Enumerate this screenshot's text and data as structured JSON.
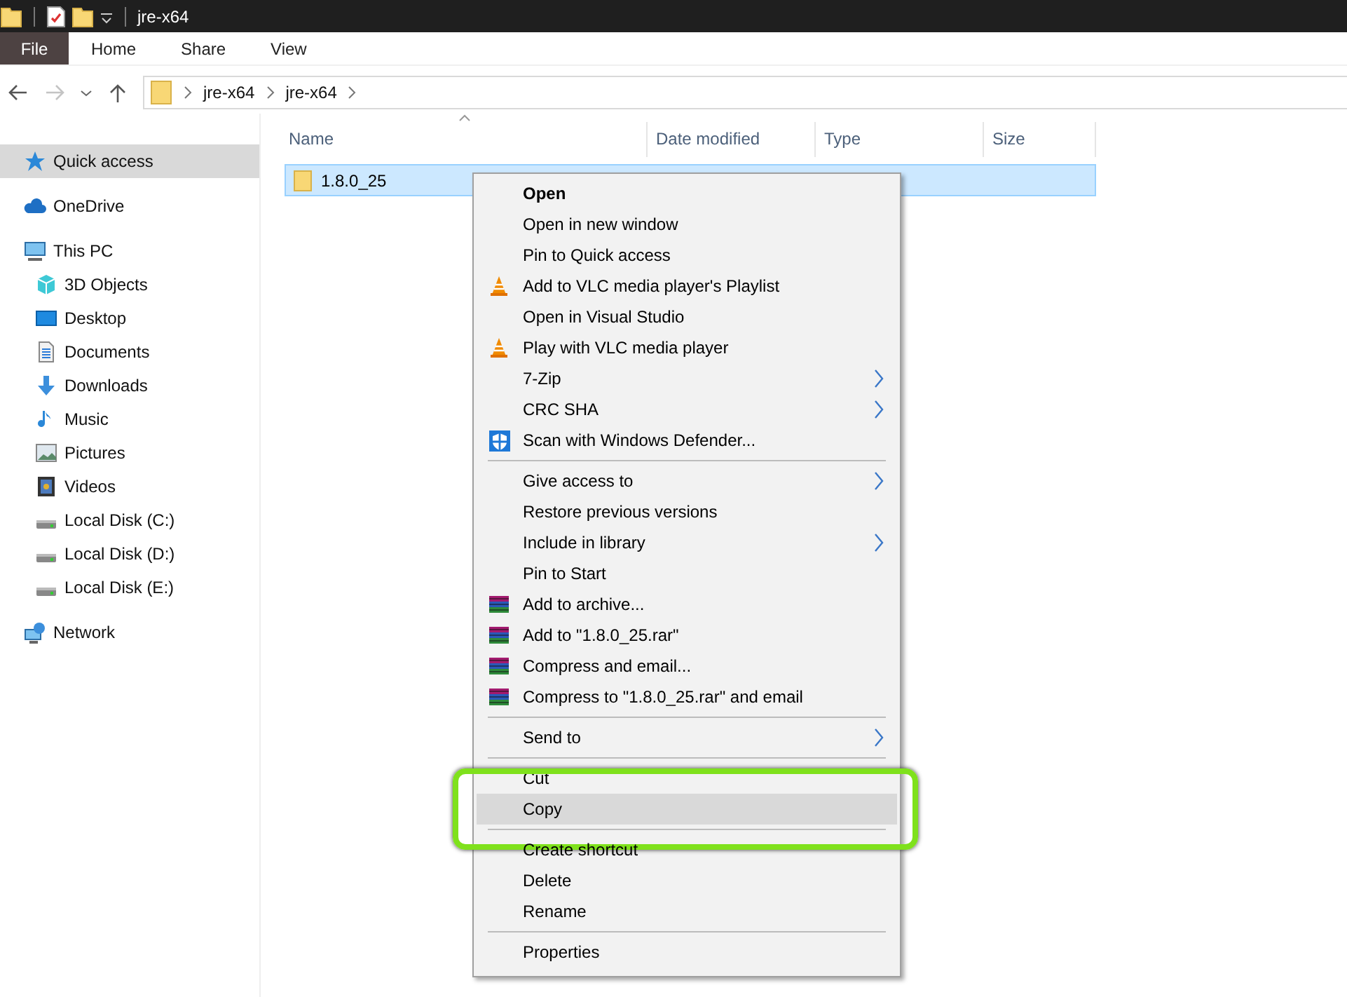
{
  "window": {
    "title": "jre-x64"
  },
  "ribbon_tabs": [
    {
      "label": "File",
      "kind": "file"
    },
    {
      "label": "Home",
      "kind": "tab"
    },
    {
      "label": "Share",
      "kind": "tab"
    },
    {
      "label": "View",
      "kind": "tab"
    }
  ],
  "navigation": {
    "forward_disabled": true
  },
  "breadcrumbs": [
    "jre-x64",
    "jre-x64"
  ],
  "sidebar": {
    "items": [
      {
        "label": "Quick access",
        "kind": "star",
        "selected": true
      },
      {
        "label": "OneDrive",
        "kind": "cloud",
        "selected": false
      },
      {
        "label": "This PC",
        "kind": "pc",
        "selected": false,
        "children": [
          {
            "label": "3D Objects",
            "kind": "cube",
            "selected": false
          },
          {
            "label": "Desktop",
            "kind": "desktop",
            "selected": false
          },
          {
            "label": "Documents",
            "kind": "docs",
            "selected": false
          },
          {
            "label": "Downloads",
            "kind": "download",
            "selected": false
          },
          {
            "label": "Music",
            "kind": "music",
            "selected": false
          },
          {
            "label": "Pictures",
            "kind": "pictures",
            "selected": false
          },
          {
            "label": "Videos",
            "kind": "videos",
            "selected": false
          },
          {
            "label": "Local Disk (C:)",
            "kind": "disk",
            "selected": false
          },
          {
            "label": "Local Disk (D:)",
            "kind": "disk",
            "selected": false
          },
          {
            "label": "Local Disk (E:)",
            "kind": "disk",
            "selected": false
          }
        ]
      },
      {
        "label": "Network",
        "kind": "network",
        "selected": false
      }
    ]
  },
  "file_list": {
    "columns": [
      "Name",
      "Date modified",
      "Type",
      "Size"
    ],
    "rows": [
      {
        "name": "1.8.0_25",
        "selected": true
      }
    ]
  },
  "context_menu": {
    "items": [
      {
        "kind": "plain",
        "label": "Open",
        "bold": true,
        "submenu": false,
        "highlighted": false
      },
      {
        "kind": "plain",
        "label": "Open in new window",
        "bold": false,
        "submenu": false,
        "highlighted": false
      },
      {
        "kind": "plain",
        "label": "Pin to Quick access",
        "bold": false,
        "submenu": false,
        "highlighted": false
      },
      {
        "kind": "vlc",
        "label": "Add to VLC media player's Playlist",
        "bold": false,
        "submenu": false,
        "highlighted": false
      },
      {
        "kind": "plain",
        "label": "Open in Visual Studio",
        "bold": false,
        "submenu": false,
        "highlighted": false
      },
      {
        "kind": "vlc",
        "label": "Play with VLC media player",
        "bold": false,
        "submenu": false,
        "highlighted": false
      },
      {
        "kind": "plain",
        "label": "7-Zip",
        "bold": false,
        "submenu": true,
        "highlighted": false
      },
      {
        "kind": "plain",
        "label": "CRC SHA",
        "bold": false,
        "submenu": true,
        "highlighted": false
      },
      {
        "kind": "defender",
        "label": "Scan with Windows Defender...",
        "bold": false,
        "submenu": false,
        "highlighted": false
      },
      {
        "kind": "separator"
      },
      {
        "kind": "plain",
        "label": "Give access to",
        "bold": false,
        "submenu": true,
        "highlighted": false
      },
      {
        "kind": "plain",
        "label": "Restore previous versions",
        "bold": false,
        "submenu": false,
        "highlighted": false
      },
      {
        "kind": "plain",
        "label": "Include in library",
        "bold": false,
        "submenu": true,
        "highlighted": false
      },
      {
        "kind": "plain",
        "label": "Pin to Start",
        "bold": false,
        "submenu": false,
        "highlighted": false
      },
      {
        "kind": "winrar",
        "label": "Add to archive...",
        "bold": false,
        "submenu": false,
        "highlighted": false
      },
      {
        "kind": "winrar",
        "label": "Add to \"1.8.0_25.rar\"",
        "bold": false,
        "submenu": false,
        "highlighted": false
      },
      {
        "kind": "winrar",
        "label": "Compress and email...",
        "bold": false,
        "submenu": false,
        "highlighted": false
      },
      {
        "kind": "winrar",
        "label": "Compress to \"1.8.0_25.rar\" and email",
        "bold": false,
        "submenu": false,
        "highlighted": false
      },
      {
        "kind": "separator"
      },
      {
        "kind": "plain",
        "label": "Send to",
        "bold": false,
        "submenu": true,
        "highlighted": false
      },
      {
        "kind": "separator"
      },
      {
        "kind": "plain",
        "label": "Cut",
        "bold": false,
        "submenu": false,
        "highlighted": false
      },
      {
        "kind": "plain",
        "label": "Copy",
        "bold": false,
        "submenu": false,
        "highlighted": true,
        "circled": true
      },
      {
        "kind": "separator"
      },
      {
        "kind": "plain",
        "label": "Create shortcut",
        "bold": false,
        "submenu": false,
        "highlighted": false
      },
      {
        "kind": "plain",
        "label": "Delete",
        "bold": false,
        "submenu": false,
        "highlighted": false
      },
      {
        "kind": "plain",
        "label": "Rename",
        "bold": false,
        "submenu": false,
        "highlighted": false
      },
      {
        "kind": "separator"
      },
      {
        "kind": "plain",
        "label": "Properties",
        "bold": false,
        "submenu": false,
        "highlighted": false
      }
    ]
  }
}
